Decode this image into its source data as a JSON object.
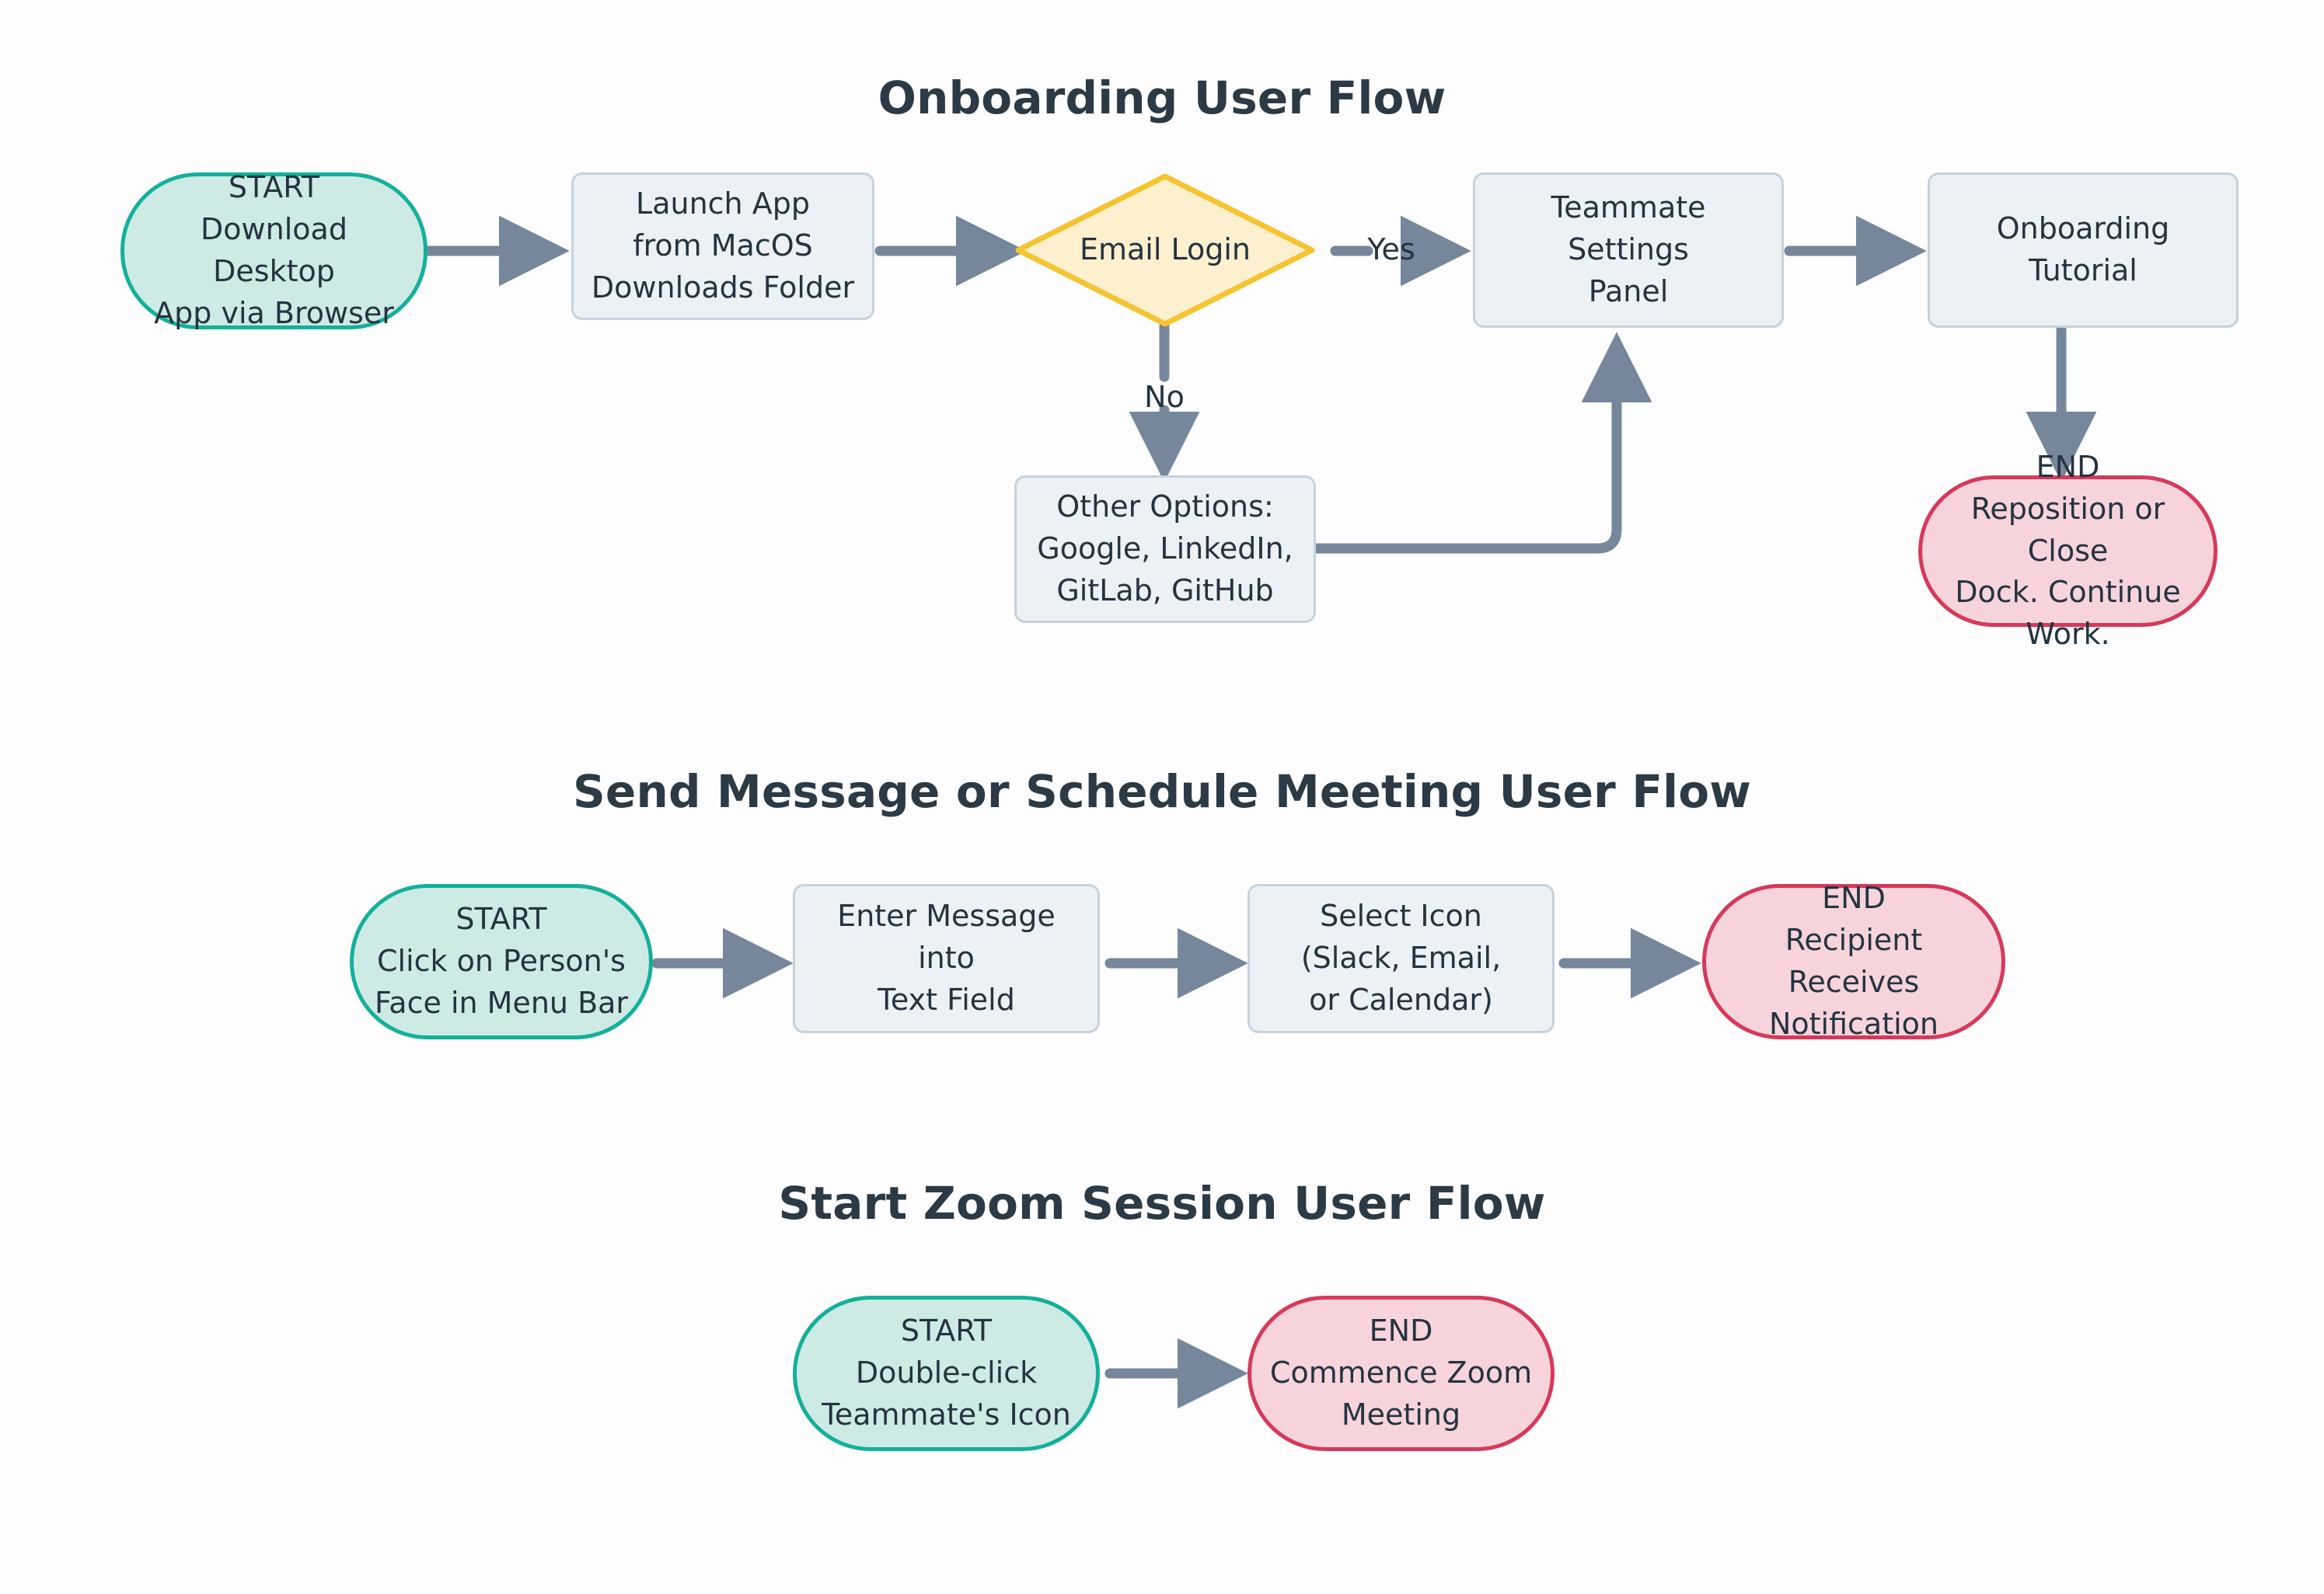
{
  "page": {
    "background_color": "#fdfdfd",
    "text_color": "#253340",
    "title_color": "#2b3a45"
  },
  "palette": {
    "start_fill": "#cdebe4",
    "start_border": "#13b09a",
    "end_fill": "#f7d4dc",
    "end_border": "#d7395a",
    "process_fill": "#ecf1f5",
    "process_border": "#c6d2dd",
    "decision_fill": "#fdf0ce",
    "decision_border": "#f5c431",
    "edge_color": "#76879b"
  },
  "flows": [
    {
      "id": "onboarding",
      "title": "Onboarding User Flow",
      "nodes": [
        {
          "id": "ob-start",
          "type": "start",
          "label": "START\nDownload Desktop\nApp via Browser"
        },
        {
          "id": "ob-launch",
          "type": "process",
          "label": "Launch App\nfrom MacOS\nDownloads Folder"
        },
        {
          "id": "ob-decision",
          "type": "decision",
          "label": "Email Login"
        },
        {
          "id": "ob-settings",
          "type": "process",
          "label": "Teammate Settings\nPanel"
        },
        {
          "id": "ob-tutorial",
          "type": "process",
          "label": "Onboarding Tutorial"
        },
        {
          "id": "ob-other",
          "type": "process",
          "label": "Other Options:\nGoogle, LinkedIn,\nGitLab, GitHub"
        },
        {
          "id": "ob-end",
          "type": "end",
          "label": "END\nReposition or Close\nDock. Continue Work."
        }
      ],
      "edges": [
        {
          "from": "ob-start",
          "to": "ob-launch",
          "label": ""
        },
        {
          "from": "ob-launch",
          "to": "ob-decision",
          "label": ""
        },
        {
          "from": "ob-decision",
          "to": "ob-settings",
          "label": "Yes"
        },
        {
          "from": "ob-decision",
          "to": "ob-other",
          "label": "No"
        },
        {
          "from": "ob-other",
          "to": "ob-settings",
          "label": ""
        },
        {
          "from": "ob-settings",
          "to": "ob-tutorial",
          "label": ""
        },
        {
          "from": "ob-tutorial",
          "to": "ob-end",
          "label": ""
        }
      ]
    },
    {
      "id": "message",
      "title": "Send Message or Schedule Meeting User Flow",
      "nodes": [
        {
          "id": "ms-start",
          "type": "start",
          "label": "START\nClick on Person's\nFace in Menu Bar"
        },
        {
          "id": "ms-enter",
          "type": "process",
          "label": "Enter Message into\nText Field"
        },
        {
          "id": "ms-select",
          "type": "process",
          "label": "Select Icon\n(Slack, Email,\nor Calendar)"
        },
        {
          "id": "ms-end",
          "type": "end",
          "label": "END\nRecipient Receives\nNotification"
        }
      ],
      "edges": [
        {
          "from": "ms-start",
          "to": "ms-enter",
          "label": ""
        },
        {
          "from": "ms-enter",
          "to": "ms-select",
          "label": ""
        },
        {
          "from": "ms-select",
          "to": "ms-end",
          "label": ""
        }
      ]
    },
    {
      "id": "zoom",
      "title": "Start Zoom Session User Flow",
      "nodes": [
        {
          "id": "zm-start",
          "type": "start",
          "label": "START\nDouble-click\nTeammate's Icon"
        },
        {
          "id": "zm-end",
          "type": "end",
          "label": "END\nCommence Zoom\nMeeting"
        }
      ],
      "edges": [
        {
          "from": "zm-start",
          "to": "zm-end",
          "label": ""
        }
      ]
    }
  ]
}
